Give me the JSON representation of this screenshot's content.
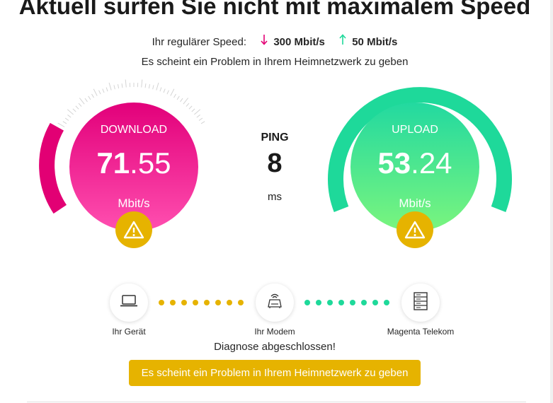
{
  "headline": "Aktuell surfen Sie nicht mit maximalem Speed",
  "regular_speed": {
    "label": "Ihr regulärer Speed:",
    "download": "300 Mbit/s",
    "upload": "50 Mbit/s"
  },
  "problem_message": "Es scheint ein Problem in Ihrem Heimnetzwerk zu geben",
  "download": {
    "label": "DOWNLOAD",
    "value_int": "71",
    "value_dec": ".55",
    "unit": "Mbit/s"
  },
  "upload": {
    "label": "UPLOAD",
    "value_int": "53",
    "value_dec": ".24",
    "unit": "Mbit/s"
  },
  "ping": {
    "label": "PING",
    "value": "8",
    "unit": "ms"
  },
  "diagnosis": {
    "nodes": [
      "Ihr Gerät",
      "Ihr Modem",
      "Magenta Telekom"
    ],
    "status": "Diagnose abgeschlossen!",
    "button_label": "Es scheint ein Problem in Ihrem Heimnetzwerk zu geben"
  },
  "colors": {
    "magenta": "#e20074",
    "green": "#1ed99a",
    "warning": "#e6b300"
  },
  "icons": [
    "download-arrow-icon",
    "upload-arrow-icon",
    "warning-icon",
    "laptop-icon",
    "modem-icon",
    "server-icon"
  ]
}
